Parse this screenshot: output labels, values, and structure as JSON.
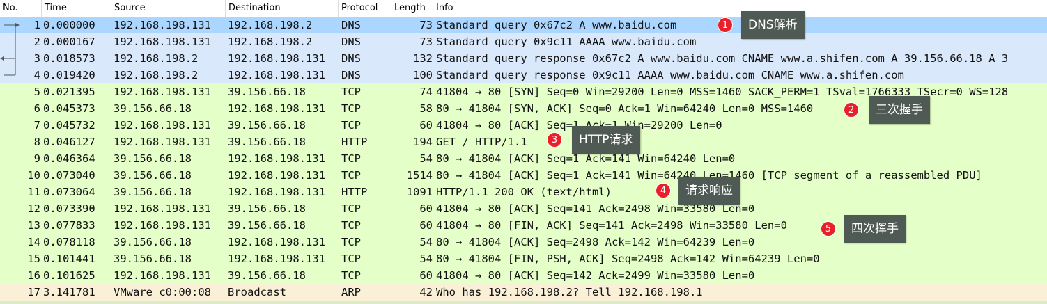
{
  "columns": {
    "no": "No.",
    "time": "Time",
    "source": "Source",
    "destination": "Destination",
    "protocol": "Protocol",
    "length": "Length",
    "info": "Info"
  },
  "colors": {
    "dns_row": "#dae8fb",
    "tcp_row": "#e4ffc7",
    "arp_row": "#faf0d7",
    "selected_row": "#abd6ff",
    "annotation_circle": "#e8202a",
    "annotation_box": "#505a54"
  },
  "packets": [
    {
      "no": "1",
      "time": "0.000000",
      "source": "192.168.198.131",
      "destination": "192.168.198.2",
      "protocol": "DNS",
      "length": "73",
      "info": "Standard query 0x67c2 A www.baidu.com"
    },
    {
      "no": "2",
      "time": "0.000167",
      "source": "192.168.198.131",
      "destination": "192.168.198.2",
      "protocol": "DNS",
      "length": "73",
      "info": "Standard query 0x9c11 AAAA www.baidu.com"
    },
    {
      "no": "3",
      "time": "0.018573",
      "source": "192.168.198.2",
      "destination": "192.168.198.131",
      "protocol": "DNS",
      "length": "132",
      "info": "Standard query response 0x67c2 A www.baidu.com CNAME www.a.shifen.com A 39.156.66.18 A 3"
    },
    {
      "no": "4",
      "time": "0.019420",
      "source": "192.168.198.2",
      "destination": "192.168.198.131",
      "protocol": "DNS",
      "length": "100",
      "info": "Standard query response 0x9c11 AAAA www.baidu.com CNAME www.a.shifen.com"
    },
    {
      "no": "5",
      "time": "0.021395",
      "source": "192.168.198.131",
      "destination": "39.156.66.18",
      "protocol": "TCP",
      "length": "74",
      "info": "41804 → 80 [SYN] Seq=0 Win=29200 Len=0 MSS=1460 SACK_PERM=1 TSval=1766333 TSecr=0 WS=128"
    },
    {
      "no": "6",
      "time": "0.045373",
      "source": "39.156.66.18",
      "destination": "192.168.198.131",
      "protocol": "TCP",
      "length": "58",
      "info": "80 → 41804 [SYN, ACK] Seq=0 Ack=1 Win=64240 Len=0 MSS=1460"
    },
    {
      "no": "7",
      "time": "0.045732",
      "source": "192.168.198.131",
      "destination": "39.156.66.18",
      "protocol": "TCP",
      "length": "60",
      "info": "41804 → 80 [ACK] Seq=1 Ack=1 Win=29200 Len=0"
    },
    {
      "no": "8",
      "time": "0.046127",
      "source": "192.168.198.131",
      "destination": "39.156.66.18",
      "protocol": "HTTP",
      "length": "194",
      "info": "GET / HTTP/1.1"
    },
    {
      "no": "9",
      "time": "0.046364",
      "source": "39.156.66.18",
      "destination": "192.168.198.131",
      "protocol": "TCP",
      "length": "54",
      "info": "80 → 41804 [ACK] Seq=1 Ack=141 Win=64240 Len=0"
    },
    {
      "no": "10",
      "time": "0.073040",
      "source": "39.156.66.18",
      "destination": "192.168.198.131",
      "protocol": "TCP",
      "length": "1514",
      "info": "80 → 41804 [ACK] Seq=1 Ack=141 Win=64240 Len=1460 [TCP segment of a reassembled PDU]"
    },
    {
      "no": "11",
      "time": "0.073064",
      "source": "39.156.66.18",
      "destination": "192.168.198.131",
      "protocol": "HTTP",
      "length": "1091",
      "info": "HTTP/1.1 200 OK  (text/html)"
    },
    {
      "no": "12",
      "time": "0.073390",
      "source": "192.168.198.131",
      "destination": "39.156.66.18",
      "protocol": "TCP",
      "length": "60",
      "info": "41804 → 80 [ACK] Seq=141 Ack=2498 Win=33580 Len=0"
    },
    {
      "no": "13",
      "time": "0.077833",
      "source": "192.168.198.131",
      "destination": "39.156.66.18",
      "protocol": "TCP",
      "length": "60",
      "info": "41804 → 80 [FIN, ACK] Seq=141 Ack=2498 Win=33580 Len=0"
    },
    {
      "no": "14",
      "time": "0.078118",
      "source": "39.156.66.18",
      "destination": "192.168.198.131",
      "protocol": "TCP",
      "length": "54",
      "info": "80 → 41804 [ACK] Seq=2498 Ack=142 Win=64239 Len=0"
    },
    {
      "no": "15",
      "time": "0.101441",
      "source": "39.156.66.18",
      "destination": "192.168.198.131",
      "protocol": "TCP",
      "length": "54",
      "info": "80 → 41804 [FIN, PSH, ACK] Seq=2498 Ack=142 Win=64239 Len=0"
    },
    {
      "no": "16",
      "time": "0.101625",
      "source": "192.168.198.131",
      "destination": "39.156.66.18",
      "protocol": "TCP",
      "length": "60",
      "info": "41804 → 80 [ACK] Seq=142 Ack=2499 Win=33580 Len=0"
    },
    {
      "no": "17",
      "time": "3.141781",
      "source": "VMware_c0:00:08",
      "destination": "Broadcast",
      "protocol": "ARP",
      "length": "42",
      "info": "Who has 192.168.198.2? Tell 192.168.198.1"
    }
  ],
  "annotations": [
    {
      "number": "1",
      "label": "DNS解析"
    },
    {
      "number": "2",
      "label": "三次握手"
    },
    {
      "number": "3",
      "label": "HTTP请求"
    },
    {
      "number": "4",
      "label": "请求响应"
    },
    {
      "number": "5",
      "label": "四次挥手"
    }
  ]
}
